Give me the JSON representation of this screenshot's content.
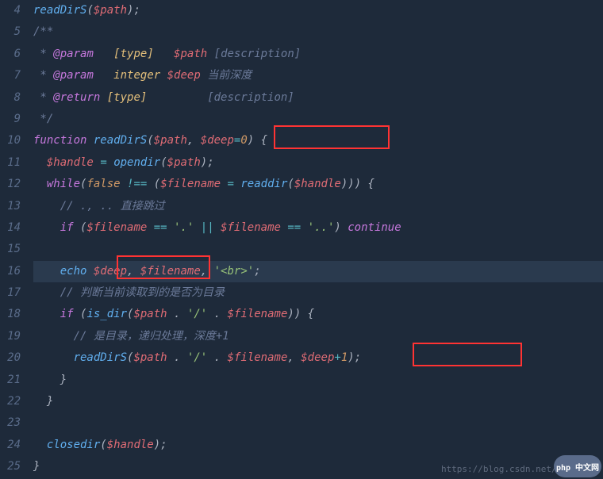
{
  "gutter": [
    "4",
    "5",
    "6",
    "7",
    "8",
    "9",
    "10",
    "11",
    "12",
    "13",
    "14",
    "15",
    "16",
    "17",
    "18",
    "19",
    "20",
    "21",
    "22",
    "23",
    "24",
    "25"
  ],
  "lines": {
    "l4": {
      "fn": "readDirS",
      "p1": "(",
      "v": "$path",
      "p2": ");"
    },
    "l5": {
      "c": "/**"
    },
    "l6": {
      "star": " * ",
      "tag": "@param",
      "sp": "   ",
      "type": "[type]",
      "sp2": "   ",
      "var": "$path",
      "sp3": " ",
      "desc": "[description]"
    },
    "l7": {
      "star": " * ",
      "tag": "@param",
      "sp": "   ",
      "type": "integer",
      "sp2": " ",
      "var": "$deep",
      "sp3": " ",
      "desc": "当前深度"
    },
    "l8": {
      "star": " * ",
      "tag": "@return",
      "sp": " ",
      "type": "[type]",
      "sp2": "         ",
      "desc": "[description]"
    },
    "l9": {
      "c": " */"
    },
    "l10": {
      "kw": "function",
      "sp": " ",
      "fn": "readDirS",
      "p1": "(",
      "v1": "$path",
      "comma": ", ",
      "v2": "$deep",
      "eq": "=",
      "num": "0",
      "p2": ") {"
    },
    "l11": {
      "ind": "  ",
      "v": "$handle",
      "sp": " ",
      "eq": "=",
      "sp2": " ",
      "fn": "opendir",
      "p1": "(",
      "v2": "$path",
      "p2": ");"
    },
    "l12": {
      "ind": "  ",
      "kw": "while",
      "p1": "(",
      "false": "false",
      "sp": " ",
      "neq": "!==",
      "sp2": " (",
      "v": "$filename",
      "sp3": " ",
      "eq": "=",
      "sp4": " ",
      "fn": "readdir",
      "p2": "(",
      "v2": "$handle",
      "p3": "))) {"
    },
    "l13": {
      "ind": "    ",
      "c": "// ., .. 直接跳过"
    },
    "l14": {
      "ind": "    ",
      "kw": "if",
      "sp": " (",
      "v": "$filename",
      "sp2": " ",
      "eq": "==",
      "sp3": " ",
      "s": "'.'",
      "sp4": " ",
      "or": "||",
      "sp5": " ",
      "v2": "$filename",
      "sp6": " ",
      "eq2": "==",
      "sp7": " ",
      "s2": "'..'",
      "p": ") ",
      "cont": "continue"
    },
    "l15": {
      "empty": ""
    },
    "l16": {
      "ind": "    ",
      "fn": "echo",
      "sp": " ",
      "v": "$deep",
      "comma": ", ",
      "v2": "$filename",
      "comma2": ", ",
      "s": "'<br>'",
      "p": ";"
    },
    "l17": {
      "ind": "    ",
      "c": "// 判断当前读取到的是否为目录"
    },
    "l18": {
      "ind": "    ",
      "kw": "if",
      "sp": " (",
      "fn": "is_dir",
      "p1": "(",
      "v": "$path",
      "sp2": " ",
      "dot": ".",
      "sp3": " ",
      "s": "'/'",
      "sp4": " ",
      "dot2": ".",
      "sp5": " ",
      "v2": "$filename",
      "p2": ")) {"
    },
    "l19": {
      "ind": "      ",
      "c": "// 是目录，递归处理，深度+1"
    },
    "l20": {
      "ind": "      ",
      "fn": "readDirS",
      "p1": "(",
      "v": "$path",
      "sp": " ",
      "dot": ".",
      "sp2": " ",
      "s": "'/'",
      "sp3": " ",
      "dot2": ".",
      "sp4": " ",
      "v2": "$filename",
      "comma": ", ",
      "v3": "$deep",
      "plus": "+",
      "num": "1",
      "p2": ");"
    },
    "l21": {
      "ind": "    }"
    },
    "l22": {
      "ind": "  }"
    },
    "l23": {
      "empty": ""
    },
    "l24": {
      "ind": "  ",
      "fn": "closedir",
      "p1": "(",
      "v": "$handle",
      "p2": ");"
    },
    "l25": {
      "ind": "}"
    }
  },
  "watermark": "https://blog.csdn.net/change_",
  "logo": "php 中文网"
}
